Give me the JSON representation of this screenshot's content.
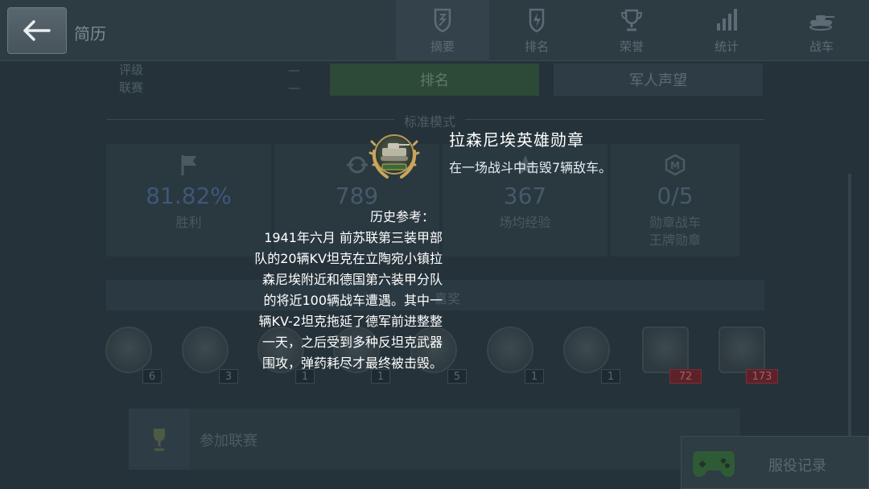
{
  "header": {
    "title": "简历",
    "tabs": [
      {
        "label": "摘要",
        "icon": "shield-icon",
        "active": true
      },
      {
        "label": "排名",
        "icon": "rank-badge-icon",
        "active": false
      },
      {
        "label": "荣誉",
        "icon": "trophy-icon",
        "active": false
      },
      {
        "label": "统计",
        "icon": "bar-chart-icon",
        "active": false
      },
      {
        "label": "战车",
        "icon": "tank-icon",
        "active": false
      }
    ]
  },
  "profile": {
    "rows": [
      {
        "label": "评级",
        "value": "—"
      },
      {
        "label": "联赛",
        "value": "—"
      }
    ],
    "rank_button": "排名",
    "reputation_button": "军人声望",
    "mode_label": "标准模式",
    "stats": [
      {
        "value": "81.82%",
        "label": "胜利",
        "icon": "flag-icon"
      },
      {
        "value": "789",
        "label": "",
        "icon": "target-icon"
      },
      {
        "value": "367",
        "label": "场均经验",
        "icon": "star-icon"
      },
      {
        "value": "0/5",
        "label": "勋章战车",
        "label2": "王牌勋章",
        "icon": "mastery-icon"
      }
    ],
    "awards_label": "嘉奖",
    "medals": [
      {
        "count": "6",
        "red": false
      },
      {
        "count": "3",
        "red": false
      },
      {
        "count": "1",
        "red": false
      },
      {
        "count": "1",
        "red": false
      },
      {
        "count": "5",
        "red": false
      },
      {
        "count": "1",
        "red": false
      },
      {
        "count": "1",
        "red": false
      },
      {
        "count": "72",
        "red": true
      },
      {
        "count": "173",
        "red": true
      }
    ],
    "league_label": "参加联赛",
    "service_record": "服役记录"
  },
  "tooltip": {
    "title": "拉森尼埃英雄勋章",
    "description": "在一场战斗中击毁7辆敌车。",
    "history_title": "历史参考：",
    "history_lines": [
      "1941年六月 前苏联第三装甲部",
      "队的20辆KV坦克在立陶宛小镇拉",
      "森尼埃附近和德国第六装甲分队",
      "的将近100辆战车遭遇。其中一",
      "辆KV-2坦克拖延了德军前进整整",
      "一天，之后受到多种反坦克武器",
      "围攻，弹药耗尽才最终被击毁。"
    ]
  }
}
